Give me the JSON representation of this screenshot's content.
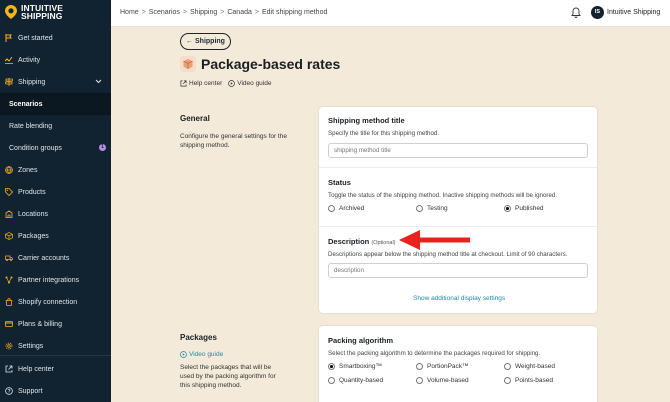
{
  "brand": {
    "name_line1": "INTUITIVE",
    "name_line2": "SHIPPING"
  },
  "sidebar": {
    "items": [
      {
        "label": "Get started"
      },
      {
        "label": "Activity"
      },
      {
        "label": "Shipping"
      },
      {
        "label": "Scenarios"
      },
      {
        "label": "Rate blending"
      },
      {
        "label": "Condition groups",
        "badge": "1"
      },
      {
        "label": "Zones"
      },
      {
        "label": "Products"
      },
      {
        "label": "Locations"
      },
      {
        "label": "Packages"
      },
      {
        "label": "Carrier accounts"
      },
      {
        "label": "Partner integrations"
      },
      {
        "label": "Shopify connection"
      },
      {
        "label": "Plans & billing"
      },
      {
        "label": "Settings"
      }
    ],
    "bottom": [
      {
        "label": "Help center"
      },
      {
        "label": "Support"
      }
    ]
  },
  "breadcrumb": [
    "Home",
    "Scenarios",
    "Shipping",
    "Canada",
    "Edit shipping method"
  ],
  "user": {
    "initials": "IS",
    "name": "Intuitive Shipping"
  },
  "back_button": "Shipping",
  "page_title": "Package-based rates",
  "help_links": {
    "help": "Help center",
    "video": "Video guide"
  },
  "general": {
    "heading": "General",
    "description": "Configure the general settings for the shipping method.",
    "title_field": {
      "label": "Shipping method title",
      "help": "Specify the title for this shipping method.",
      "placeholder": "shipping method title"
    },
    "status": {
      "label": "Status",
      "help": "Toggle the status of the shipping method. Inactive shipping methods will be ignored.",
      "options": [
        "Archived",
        "Testing",
        "Published"
      ],
      "selected": "Published"
    },
    "description_field": {
      "label": "Description",
      "optional": "(Optional)",
      "help": "Descriptions appear below the shipping method title at checkout. Limit of 90 characters.",
      "placeholder": "description"
    },
    "more_link": "Show additional display settings"
  },
  "packages": {
    "heading": "Packages",
    "video": "Video guide",
    "description": "Select the packages that will be used by the packing algorithm for this shipping method.",
    "algorithm": {
      "label": "Packing algorithm",
      "help": "Select the packing algorithm to determine the packages required for shipping.",
      "options": [
        "Smartboxing™",
        "PortionPack™",
        "Weight-based",
        "Quantity-based",
        "Volume-based",
        "Points-based"
      ],
      "selected": "Smartboxing™"
    }
  },
  "colors": {
    "sidebar": "#112230",
    "accent": "#f5b321",
    "background": "#f4ead9",
    "link": "#1c8da3",
    "annotation_arrow": "#e8231d"
  }
}
